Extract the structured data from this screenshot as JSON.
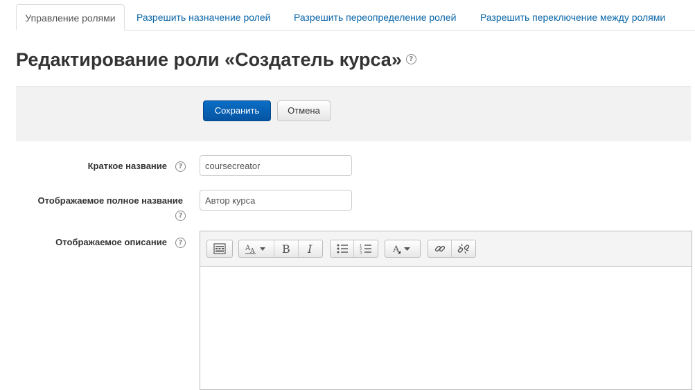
{
  "tabs": [
    {
      "label": "Управление ролями",
      "active": true
    },
    {
      "label": "Разрешить назначение ролей",
      "active": false
    },
    {
      "label": "Разрешить переопределение ролей",
      "active": false
    },
    {
      "label": "Разрешить переключение между ролями",
      "active": false
    }
  ],
  "page": {
    "title": "Редактирование роли «Создатель курса»"
  },
  "buttons": {
    "save": "Сохранить",
    "cancel": "Отмена"
  },
  "form": {
    "shortname": {
      "label": "Краткое название",
      "value": "coursecreator"
    },
    "fullname": {
      "label": "Отображаемое полное название",
      "value": "Автор курса"
    },
    "description": {
      "label": "Отображаемое описание",
      "value": ""
    }
  },
  "editor_toolbar": {
    "icons": [
      "toolbar-toggle-icon",
      "font-size-icon",
      "bold-icon",
      "italic-icon",
      "unordered-list-icon",
      "ordered-list-icon",
      "text-color-icon",
      "link-icon",
      "unlink-icon"
    ]
  },
  "colors": {
    "link": "#0a66a8",
    "primary_button": "#0654a3",
    "panel_bg": "#f2f2f2"
  }
}
